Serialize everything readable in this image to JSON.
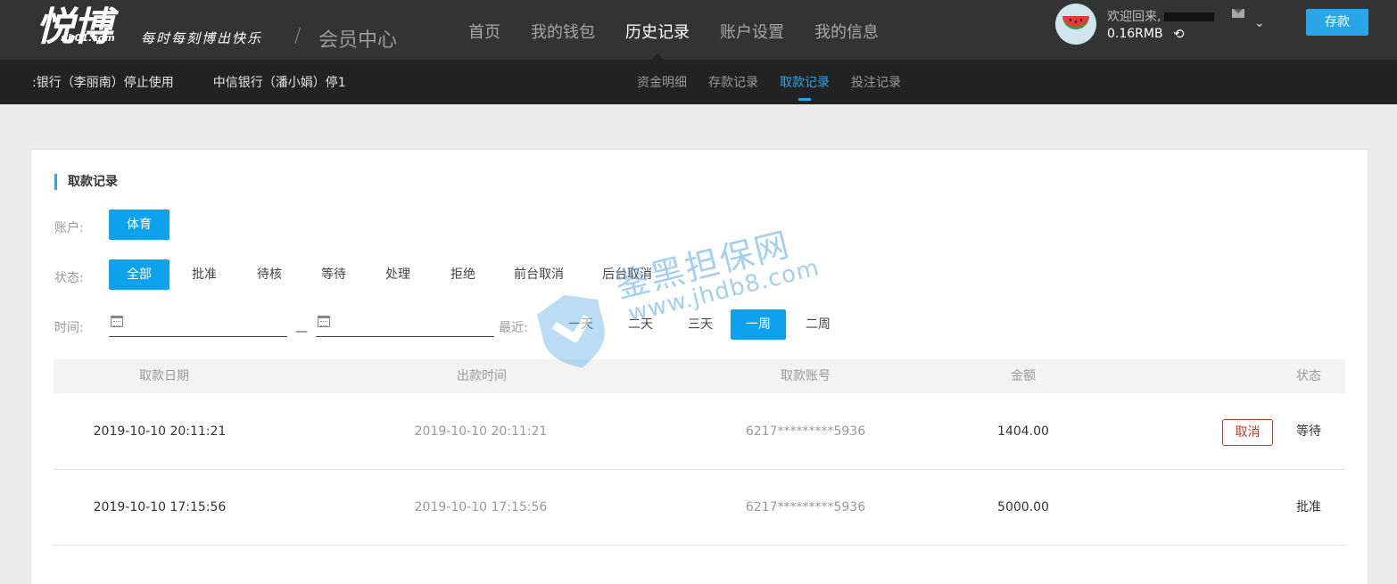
{
  "brand": {
    "logo_main": "悦博",
    "logo_sub": "nb01.com",
    "slogan": "每时每刻博出快乐",
    "section_title": "会员中心"
  },
  "nav": {
    "items": [
      {
        "label": "首页"
      },
      {
        "label": "我的钱包"
      },
      {
        "label": "历史记录",
        "active": true
      },
      {
        "label": "账户设置"
      },
      {
        "label": "我的信息"
      }
    ]
  },
  "user": {
    "welcome": "欢迎回来,",
    "balance": "0.16RMB",
    "deposit_label": "存款"
  },
  "marquee": {
    "items": [
      ":银行（李丽南）停止使用",
      "中信银行（潘小娟）停1"
    ]
  },
  "subnav": {
    "items": [
      {
        "label": "资金明细"
      },
      {
        "label": "存款记录"
      },
      {
        "label": "取款记录",
        "active": true
      },
      {
        "label": "投注记录"
      }
    ]
  },
  "panel": {
    "title": "取款记录",
    "account_label": "账户:",
    "account_options": [
      {
        "label": "体育",
        "active": true
      }
    ],
    "status_label": "状态:",
    "status_options": [
      {
        "label": "全部",
        "active": true
      },
      {
        "label": "批准"
      },
      {
        "label": "待核"
      },
      {
        "label": "等待"
      },
      {
        "label": "处理"
      },
      {
        "label": "拒绝"
      },
      {
        "label": "前台取消"
      },
      {
        "label": "后台取消"
      }
    ],
    "time_label": "时间:",
    "date_from": "",
    "date_to": "",
    "date_separator": "—",
    "recent_label": "最近:",
    "recent_options": [
      {
        "label": "一天"
      },
      {
        "label": "二天"
      },
      {
        "label": "三天"
      },
      {
        "label": "一周",
        "active": true
      },
      {
        "label": "二周"
      }
    ]
  },
  "table": {
    "columns": [
      "取款日期",
      "出款时间",
      "取款账号",
      "金额",
      "状态"
    ],
    "rows": [
      {
        "request_date": "2019-10-10 20:11:21",
        "payout_time": "2019-10-10 20:11:21",
        "account": "6217*********5936",
        "amount": "1404.00",
        "action": "取消",
        "status": "等待"
      },
      {
        "request_date": "2019-10-10 17:15:56",
        "payout_time": "2019-10-10 17:15:56",
        "account": "6217*********5936",
        "amount": "5000.00",
        "action": "",
        "status": "批准"
      }
    ]
  },
  "watermark": {
    "text": "鉴黑担保网",
    "url": "www.jhdb8.com"
  },
  "colors": {
    "accent": "#0ea2ee",
    "topbar": "#333333",
    "subbar": "#222222",
    "cancel": "#c0392b"
  }
}
